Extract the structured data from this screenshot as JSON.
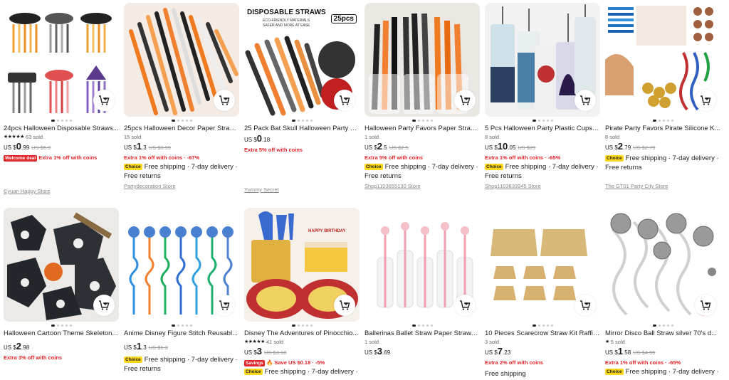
{
  "accent_color": "#e0252a",
  "choice_color": "#fdd819",
  "products": [
    {
      "id": 0,
      "title": "24pcs Halloween Disposable Straws...",
      "rating": "★★★★★",
      "sold": "63 sold",
      "currency": "US $",
      "price_int": "0",
      "price_dec": ".99",
      "old_price": "US $5.9",
      "pct": "",
      "badge": "Welcome deal",
      "promo": "Extra 1% off with coins",
      "promo_pct": "",
      "choice": "",
      "shipping": "",
      "returns": "",
      "store": "Cyuan Happy Store"
    },
    {
      "id": 1,
      "title": "25pcs Halloween Decor Paper Straw...",
      "rating": "",
      "sold": "15 sold",
      "currency": "US $",
      "price_int": "1",
      "price_dec": ".3",
      "old_price": "US $3.99",
      "pct": "",
      "badge": "",
      "promo": "Extra 1% off with coins",
      "promo_pct": "· -67%",
      "choice": "Choice",
      "shipping": "Free shipping · 7-day delivery ·",
      "returns": "Free returns",
      "store": "Partydecoration Store"
    },
    {
      "id": 2,
      "title": "25 Pack Bat Skull Halloween Party St...",
      "rating": "",
      "sold": "",
      "currency": "US $",
      "price_int": "0",
      "price_dec": ".18",
      "old_price": "",
      "pct": "",
      "badge": "",
      "promo": "Extra 5% off with coins",
      "promo_pct": "",
      "choice": "",
      "shipping": "",
      "returns": "",
      "store": "Yummy Secret",
      "img_text": "DISPOSABLE STRAWS",
      "img_sub1": "ECO-FRIENDLY MATERIALS",
      "img_sub2": "SAFER AND MORE AT EASE",
      "img_badge": "25pcs"
    },
    {
      "id": 3,
      "title": "Halloween Party Favors Paper Straw...",
      "rating": "",
      "sold": "1 sold",
      "currency": "US $",
      "price_int": "2",
      "price_dec": ".5",
      "old_price": "US $2.5",
      "pct": "",
      "badge": "",
      "promo": "Extra 5% off with coins",
      "promo_pct": "",
      "choice": "Choice",
      "shipping": "Free shipping · 7-day delivery ·",
      "returns": "Free returns",
      "store": "Shop1103655130 Store"
    },
    {
      "id": 4,
      "title": "5 Pcs Halloween Party Plastic Cups, ...",
      "rating": "",
      "sold": "8 sold",
      "currency": "US $",
      "price_int": "10",
      "price_dec": ".05",
      "old_price": "US $29",
      "pct": "",
      "badge": "",
      "promo": "Extra 1% off with coins",
      "promo_pct": "· -65%",
      "choice": "Choice",
      "shipping": "Free shipping · 7-day delivery ·",
      "returns": "Free returns",
      "store": "Shop1103833945 Store"
    },
    {
      "id": 5,
      "title": "Pirate Party Favors Pirate Silicone K...",
      "rating": "",
      "sold": "8 sold",
      "currency": "US $",
      "price_int": "2",
      "price_dec": ".79",
      "old_price": "US $2.79",
      "pct": "",
      "badge": "",
      "promo": "",
      "promo_pct": "",
      "choice": "Choice",
      "shipping": "Free shipping · 7-day delivery ·",
      "returns": "Free returns",
      "store": "The GT01 Party City Store"
    },
    {
      "id": 6,
      "title": "Halloween Cartoon Theme Skeleton...",
      "rating": "",
      "sold": "",
      "currency": "US $",
      "price_int": "2",
      "price_dec": ".98",
      "old_price": "",
      "pct": "",
      "badge": "",
      "promo": "Extra 3% off with coins",
      "promo_pct": "",
      "choice": "",
      "shipping": "",
      "returns": "",
      "store": ""
    },
    {
      "id": 7,
      "title": "Anime Disney Figure Stitch Reusabl...",
      "rating": "",
      "sold": "",
      "currency": "US $",
      "price_int": "1",
      "price_dec": ".3",
      "old_price": "US $1.3",
      "pct": "",
      "badge": "",
      "promo": "",
      "promo_pct": "",
      "choice": "Choice",
      "shipping": "Free shipping · 7-day delivery ·",
      "returns": "Free returns",
      "store": ""
    },
    {
      "id": 8,
      "title": "Disney The Adventures of Pinocchio...",
      "rating": "★★★★★",
      "sold": "41 sold",
      "currency": "US $",
      "price_int": "3",
      "price_dec": "",
      "old_price": "US $3.18",
      "pct": "",
      "badge": "Savings",
      "promo": "Save US $0.18",
      "promo_pct": "· -5%",
      "choice": "Choice",
      "shipping": "Free shipping · 7-day delivery ·",
      "returns": "",
      "store": "",
      "img_text": "HAPPY BIRTHDAY"
    },
    {
      "id": 9,
      "title": "Ballerinas Ballet Straw Paper Straws...",
      "rating": "",
      "sold": "1 sold",
      "currency": "US $",
      "price_int": "3",
      "price_dec": ".69",
      "old_price": "",
      "pct": "",
      "badge": "",
      "promo": "",
      "promo_pct": "",
      "choice": "",
      "shipping": "",
      "returns": "",
      "store": ""
    },
    {
      "id": 10,
      "title": "10 Pieces Scarecrow Straw Kit Raffia...",
      "rating": "",
      "sold": "3 sold",
      "currency": "US $",
      "price_int": "7",
      "price_dec": ".23",
      "old_price": "",
      "pct": "",
      "badge": "",
      "promo": "Extra 2% off with coins",
      "promo_pct": "",
      "choice": "",
      "shipping": "Free shipping",
      "returns": "",
      "store": ""
    },
    {
      "id": 11,
      "title": "Mirror Disco Ball Straw silver 70's d...",
      "rating": "★",
      "sold": "5 sold",
      "currency": "US $",
      "price_int": "1",
      "price_dec": ".58",
      "old_price": "US $4.55",
      "pct": "",
      "badge": "",
      "promo": "Extra 1% off with coins",
      "promo_pct": "· -65%",
      "choice": "Choice",
      "shipping": "Free shipping · 7-day delivery ·",
      "returns": "",
      "store": ""
    }
  ]
}
